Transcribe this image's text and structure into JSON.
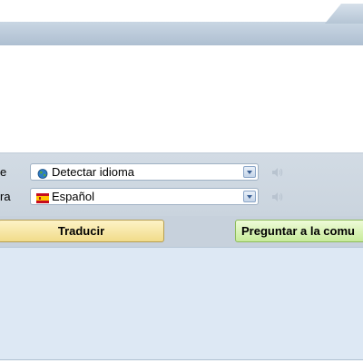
{
  "translator": {
    "source_row": {
      "label": "e",
      "language": "Detectar idioma",
      "icon": "globe-icon"
    },
    "target_row": {
      "label": "ra",
      "language": "Español",
      "icon": "spain-flag-icon"
    },
    "translate_button": "Traducir",
    "ask_community_button": "Preguntar a la comu"
  },
  "colors": {
    "translate_button": "#f5e29a",
    "ask_button": "#d3f0ad",
    "controls_band": "#cdd7e1",
    "output_area": "#dde8f4"
  }
}
